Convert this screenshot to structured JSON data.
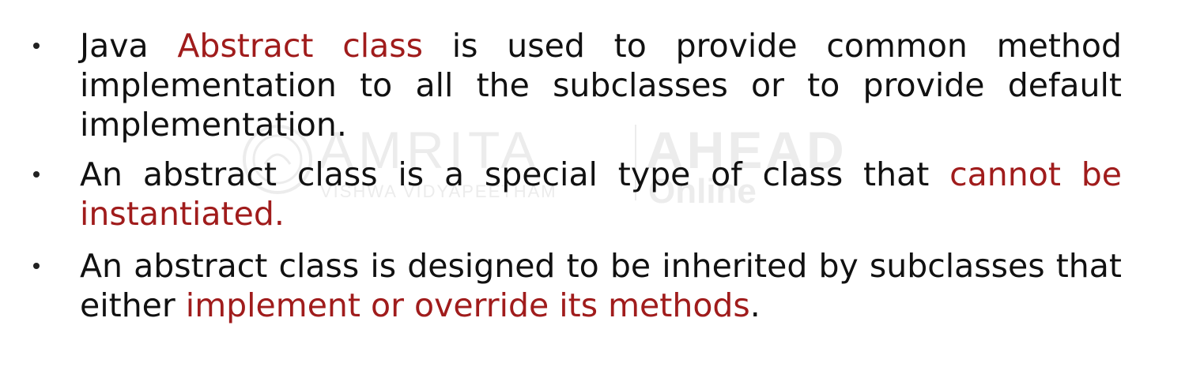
{
  "watermark": {
    "brand": "AMRITA",
    "subtitle": "VISHWA VIDYAPEETHAM",
    "right_brand": "AHEAD",
    "right_sub": "Online",
    "color": "#ececec"
  },
  "accent_color": "#a01c1c",
  "bullets": [
    {
      "segments": [
        {
          "text": "Java ",
          "highlight": false
        },
        {
          "text": "Abstract class",
          "highlight": true
        },
        {
          "text": " is used to provide common method implementation to all the subclasses or to provide default implementation.",
          "highlight": false
        }
      ]
    },
    {
      "segments": [
        {
          "text": "An abstract class is a special type of class that ",
          "highlight": false
        },
        {
          "text": "cannot be instantiated.",
          "highlight": true
        }
      ]
    },
    {
      "segments": [
        {
          "text": "An abstract class is designed to be inherited by subclasses that either ",
          "highlight": false
        },
        {
          "text": "implement or override its methods",
          "highlight": true
        },
        {
          "text": ".",
          "highlight": false
        }
      ]
    }
  ]
}
